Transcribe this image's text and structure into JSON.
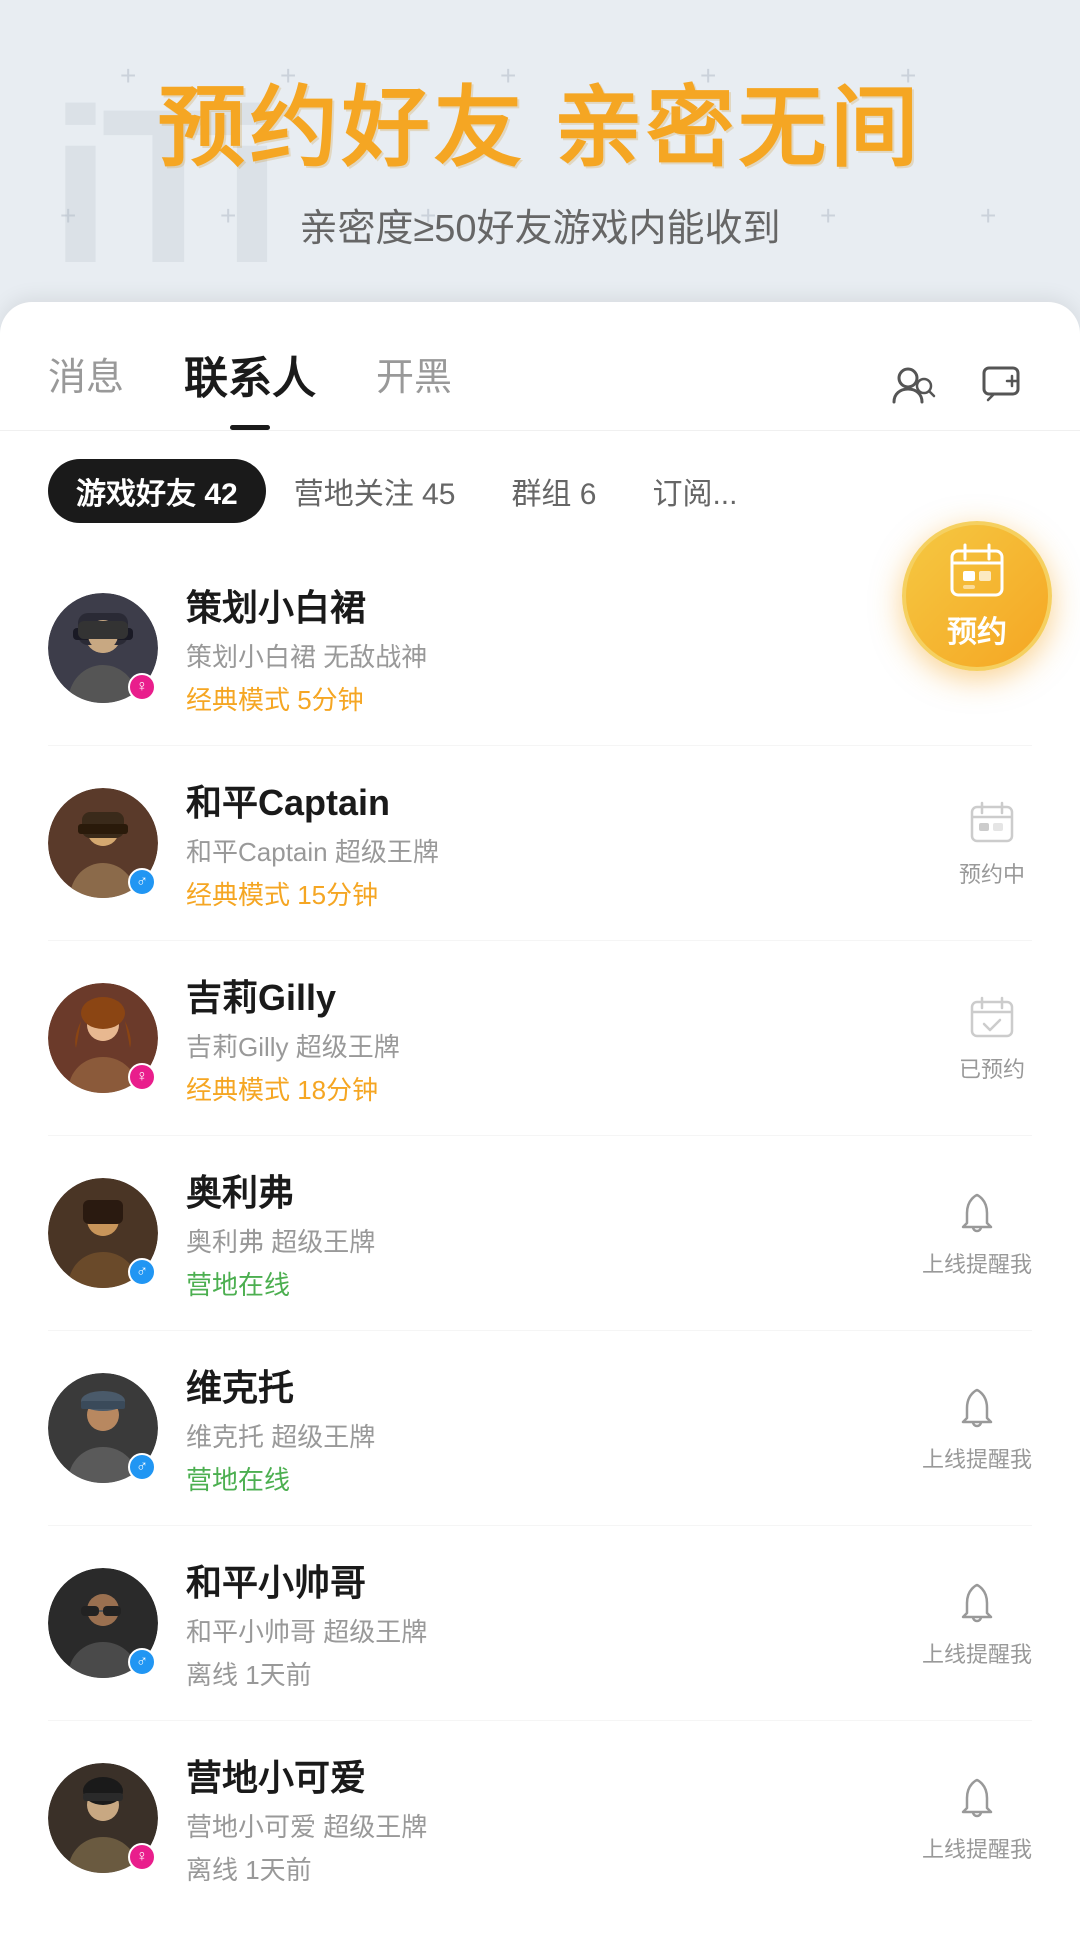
{
  "hero": {
    "title": "预约好友 亲密无间",
    "subtitle": "亲密度≥50好友游戏内能收到"
  },
  "tabs": {
    "items": [
      {
        "label": "消息",
        "active": false
      },
      {
        "label": "联系人",
        "active": true
      },
      {
        "label": "开黑",
        "active": false
      }
    ],
    "icons": [
      {
        "name": "search-people-icon"
      },
      {
        "name": "add-chat-icon"
      }
    ]
  },
  "subTabs": {
    "items": [
      {
        "label": "游戏好友 42",
        "active": true
      },
      {
        "label": "营地关注 45",
        "active": false
      },
      {
        "label": "群组 6",
        "active": false
      },
      {
        "label": "订阅...",
        "active": false
      }
    ]
  },
  "friends": [
    {
      "id": 1,
      "name": "策划小白裙",
      "meta": "策划小白裙  无敌战神",
      "status": "经典模式 5分钟",
      "statusType": "playing",
      "gender": "female",
      "action": "预约",
      "actionState": "default",
      "avatarColor": "#3d3d4a"
    },
    {
      "id": 2,
      "name": "和平Captain",
      "meta": "和平Captain  超级王牌",
      "status": "经典模式 15分钟",
      "statusType": "playing",
      "gender": "male",
      "action": "预约中",
      "actionState": "pending",
      "avatarColor": "#5a3a2a"
    },
    {
      "id": 3,
      "name": "吉莉Gilly",
      "meta": "吉莉Gilly  超级王牌",
      "status": "经典模式 18分钟",
      "statusType": "playing",
      "gender": "female",
      "action": "已预约",
      "actionState": "done",
      "avatarColor": "#6b3a2a"
    },
    {
      "id": 4,
      "name": "奥利弗",
      "meta": "奥利弗  超级王牌",
      "status": "营地在线",
      "statusType": "online",
      "gender": "male",
      "action": "上线提醒我",
      "actionState": "notify",
      "avatarColor": "#4a3525"
    },
    {
      "id": 5,
      "name": "维克托",
      "meta": "维克托  超级王牌",
      "status": "营地在线",
      "statusType": "online",
      "gender": "male",
      "action": "上线提醒我",
      "actionState": "notify",
      "avatarColor": "#3a3a3a"
    },
    {
      "id": 6,
      "name": "和平小帅哥",
      "meta": "和平小帅哥  超级王牌",
      "status": "离线  1天前",
      "statusType": "offline",
      "gender": "male",
      "action": "上线提醒我",
      "actionState": "notify",
      "avatarColor": "#2a2a2a"
    },
    {
      "id": 7,
      "name": "营地小可爱",
      "meta": "营地小可爱  超级王牌",
      "status": "离线  1天前",
      "statusType": "offline",
      "gender": "female",
      "action": "上线提醒我",
      "actionState": "notify",
      "avatarColor": "#3a3028"
    }
  ],
  "popup": {
    "label": "预约"
  },
  "colors": {
    "accent": "#f5a623",
    "active_tab": "#1a1a1a",
    "playing": "#f5a623",
    "online": "#4caf50",
    "offline": "#999999"
  }
}
